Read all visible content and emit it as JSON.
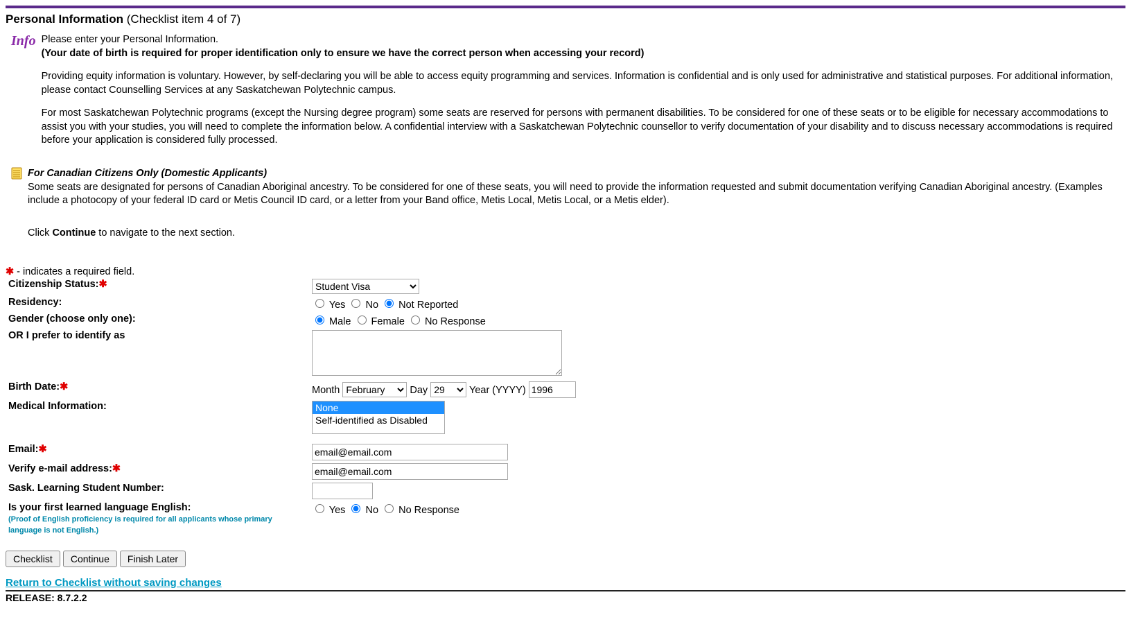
{
  "header": {
    "title_bold": "Personal Information",
    "title_suffix": " (Checklist item 4 of 7)"
  },
  "info": {
    "icon_label": "Info",
    "line1": "Please enter your Personal Information.",
    "line1_bold": "(Your date of birth is required for proper identification only to ensure we have the correct person when accessing your record)",
    "para2": "Providing equity information is voluntary. However, by self-declaring you will be able to access equity programming and services. Information is confidential and is only used for administrative and statistical purposes. For additional information, please contact Counselling Services at any Saskatchewan Polytechnic campus.",
    "para3": "For most Saskatchewan Polytechnic programs (except the Nursing degree program) some seats are reserved for persons with permanent disabilities. To be considered for one of these seats or to be eligible for necessary accommodations to assist you with your studies, you will need to complete the information below. A confidential interview with a Saskatchewan Polytechnic counsellor to verify documentation of your disability and to discuss necessary accommodations is required before your application is considered fully processed."
  },
  "note": {
    "title": "For Canadian Citizens Only (Domestic Applicants)",
    "body": "Some seats are designated for persons of Canadian Aboriginal ancestry. To be considered for one of these seats, you will need to provide the information requested and submit documentation verifying Canadian Aboriginal ancestry. (Examples include a photocopy of your federal ID card or Metis Council ID card, or a letter from your Band office, Metis Local, Metis Local, or a Metis elder)."
  },
  "continue_instr": {
    "pre": "Click ",
    "bold": "Continue",
    "post": " to navigate to the next section."
  },
  "required_legend": " - indicates a required field.",
  "labels": {
    "citizenship": "Citizenship Status:",
    "residency": "Residency:",
    "gender": "Gender (choose only one):",
    "identify_as": "OR I prefer to identify as",
    "birth_date": "Birth Date:",
    "month": "Month",
    "day": "Day",
    "year": "Year (YYYY)",
    "medical": "Medical Information:",
    "email": "Email:",
    "verify_email": "Verify e-mail address:",
    "sask_number": "Sask. Learning Student Number:",
    "first_lang": "Is your first learned language English:",
    "first_lang_note": "(Proof of English proficiency is required for all applicants whose primary language is not English.)"
  },
  "options": {
    "citizenship_selected": "Student Visa",
    "residency": [
      "Yes",
      "No",
      "Not Reported"
    ],
    "residency_selected": "Not Reported",
    "gender": [
      "Male",
      "Female",
      "No Response"
    ],
    "gender_selected": "Male",
    "month_selected": "February",
    "day_selected": "29",
    "year_value": "1996",
    "medical": [
      "None",
      "Self-identified as Disabled"
    ],
    "medical_selected": "None",
    "first_lang": [
      "Yes",
      "No",
      "No Response"
    ],
    "first_lang_selected": "No"
  },
  "values": {
    "identify_as": "",
    "email": "email@email.com",
    "verify_email": "email@email.com",
    "sask_number": ""
  },
  "buttons": {
    "checklist": "Checklist",
    "continue": "Continue",
    "finish_later": "Finish Later"
  },
  "return_link": "Return to Checklist without saving changes",
  "release": "RELEASE: 8.7.2.2"
}
